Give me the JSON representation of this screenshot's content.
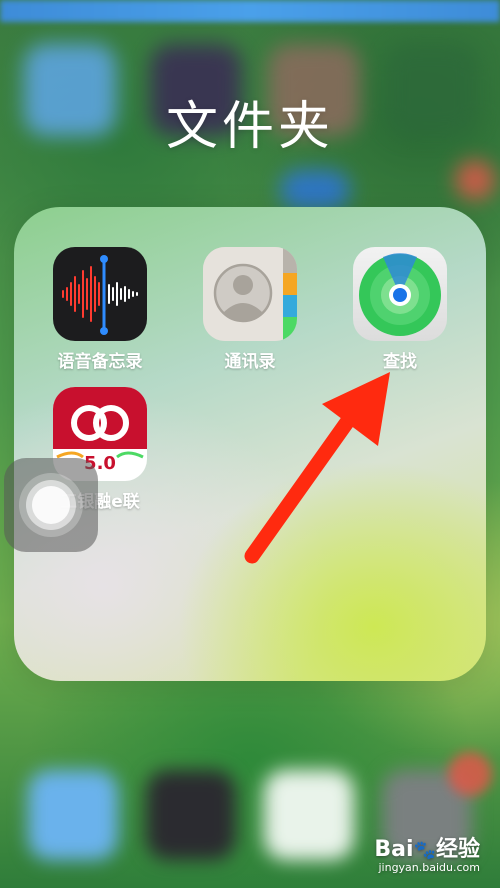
{
  "folder": {
    "title": "文件夹",
    "apps": [
      {
        "label": "语音备忘录",
        "icon": "voice-memos-icon"
      },
      {
        "label": "通讯录",
        "icon": "contacts-icon"
      },
      {
        "label": "查找",
        "icon": "find-my-icon"
      },
      {
        "label": "工银融e联",
        "icon": "icbc-e-link-icon",
        "badge": "5.0"
      }
    ]
  },
  "watermark": {
    "main_a": "Bai",
    "main_b": "经验",
    "sub": "jingyan.baidu.com"
  },
  "colors": {
    "arrow": "#ff2a0f",
    "find_my_green": "#34c759",
    "find_my_dot": "#1a73e8",
    "voice_memos_bg": "#1c1c1e",
    "icbc_red": "#c8102e"
  }
}
